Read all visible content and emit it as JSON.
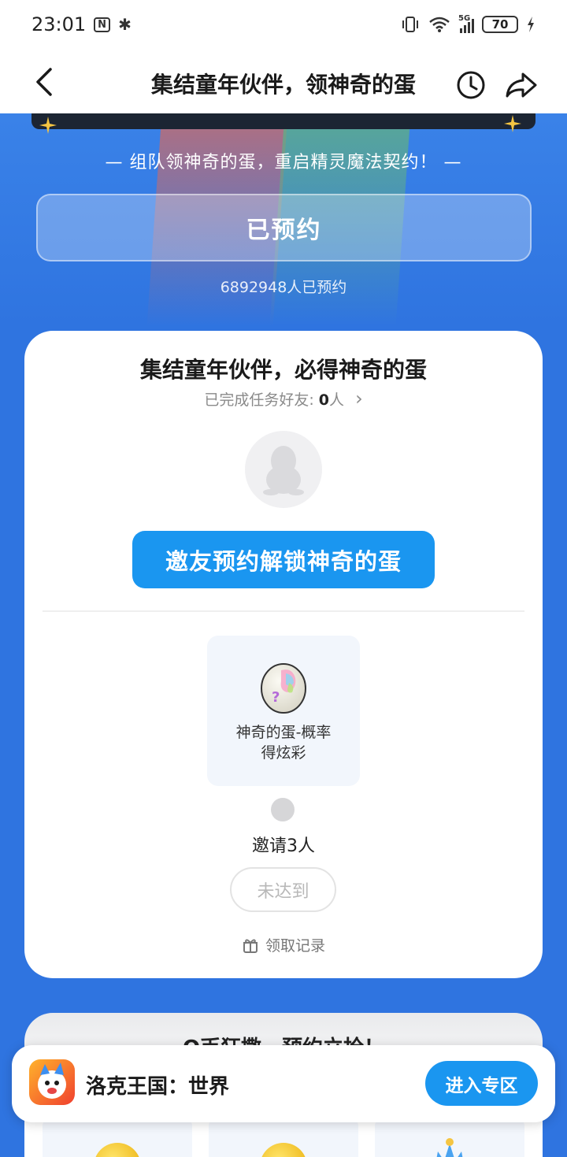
{
  "status_bar": {
    "time": "23:01",
    "nfc_icon": "N",
    "bluetooth_icon": "✱",
    "network_type": "5G",
    "battery": "70"
  },
  "nav": {
    "title": "集结童年伙伴，领神奇的蛋"
  },
  "hero": {
    "subtitle": "— 组队领神奇的蛋，重启精灵魔法契约！ —",
    "reserved_label": "已预约",
    "reserve_count": "6892948人已预约"
  },
  "card": {
    "title": "集结童年伙伴，必得神奇的蛋",
    "friends_label": "已完成任务好友: ",
    "friends_count": "0",
    "friends_unit": "人",
    "chevron": "›",
    "invite_button": "邀友预约解锁神奇的蛋",
    "reward_name": "神奇的蛋-概率得炫彩",
    "invite_target": "邀请3人",
    "status_button": "未达到",
    "claim_record": "领取记录"
  },
  "card2": {
    "title": "Q币狂撒，预约立抢！"
  },
  "app_bar": {
    "app_name": "洛克王国：世界",
    "enter_button": "进入专区"
  },
  "colors": {
    "page_bg": "#2f74e0",
    "primary_button": "#1a96f0"
  }
}
